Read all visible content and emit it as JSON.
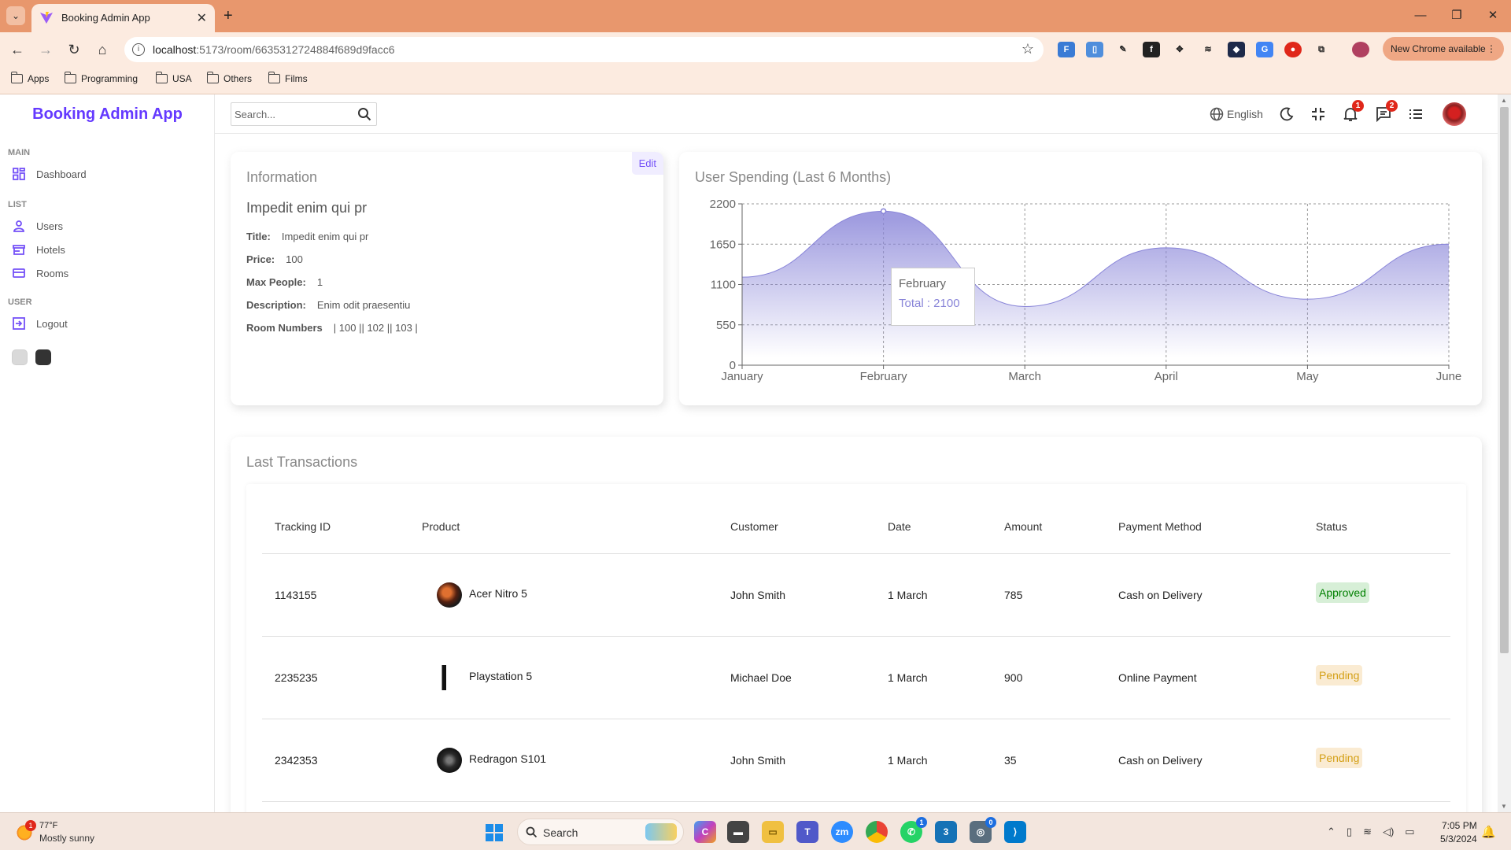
{
  "browser": {
    "tab_title": "Booking Admin App",
    "url_host": "localhost",
    "url_path": ":5173/room/6635312724884f689d9facc6",
    "new_chrome_label": "New Chrome available",
    "bookmarks": [
      "Apps",
      "Programming",
      "USA",
      "Others",
      "Films"
    ]
  },
  "app": {
    "logo": "Booking Admin App",
    "sidebar": {
      "main_title": "MAIN",
      "dashboard": "Dashboard",
      "list_title": "LIST",
      "users": "Users",
      "hotels": "Hotels",
      "rooms": "Rooms",
      "user_title": "USER",
      "logout": "Logout"
    },
    "navbar": {
      "search_placeholder": "Search...",
      "language": "English",
      "notifications_count": "1",
      "messages_count": "2"
    }
  },
  "info": {
    "heading": "Information",
    "edit_label": "Edit",
    "item_title": "Impedit enim qui pr",
    "fields": [
      {
        "key": "Title:",
        "value": "Impedit enim qui pr"
      },
      {
        "key": "Price:",
        "value": "100"
      },
      {
        "key": "Max People:",
        "value": "1"
      },
      {
        "key": "Description:",
        "value": "Enim odit praesentiu"
      },
      {
        "key": "Room Numbers",
        "value": "| 100 || 102 || 103 |"
      }
    ]
  },
  "chart_title": "User Spending (Last 6 Months)",
  "tooltip": {
    "label": "February",
    "value_text": "Total : 2100"
  },
  "chart_data": {
    "type": "area",
    "title": "User Spending (Last 6 Months)",
    "categories": [
      "January",
      "February",
      "March",
      "April",
      "May",
      "June"
    ],
    "series": [
      {
        "values": [
          1200,
          2100,
          800,
          1600,
          900,
          1650
        ]
      }
    ],
    "ylim": [
      0,
      2200
    ],
    "yticks": [
      0,
      550,
      1100,
      1650,
      2200
    ],
    "grid": true,
    "color": "#8884D8"
  },
  "transactions": {
    "heading": "Last Transactions",
    "columns": [
      "Tracking ID",
      "Product",
      "Customer",
      "Date",
      "Amount",
      "Payment Method",
      "Status"
    ],
    "rows": [
      {
        "id": "1143155",
        "product": "Acer Nitro 5",
        "customer": "John Smith",
        "date": "1 March",
        "amount": "785",
        "method": "Cash on Delivery",
        "status": "Approved"
      },
      {
        "id": "2235235",
        "product": "Playstation 5",
        "customer": "Michael Doe",
        "date": "1 March",
        "amount": "900",
        "method": "Online Payment",
        "status": "Pending"
      },
      {
        "id": "2342353",
        "product": "Redragon S101",
        "customer": "John Smith",
        "date": "1 March",
        "amount": "35",
        "method": "Cash on Delivery",
        "status": "Pending"
      }
    ],
    "status_colors": {
      "Approved": {
        "fg": "#008000",
        "bg": "#D7EFD7"
      },
      "Pending": {
        "fg": "#D4A017",
        "bg": "#FAEBD2"
      }
    }
  },
  "taskbar": {
    "temperature": "77°F",
    "weather": "Mostly sunny",
    "weather_badge": "1",
    "search_label": "Search",
    "time": "7:05 PM",
    "date": "5/3/2024",
    "whatsapp_badge": "1",
    "app_badge": "0"
  }
}
